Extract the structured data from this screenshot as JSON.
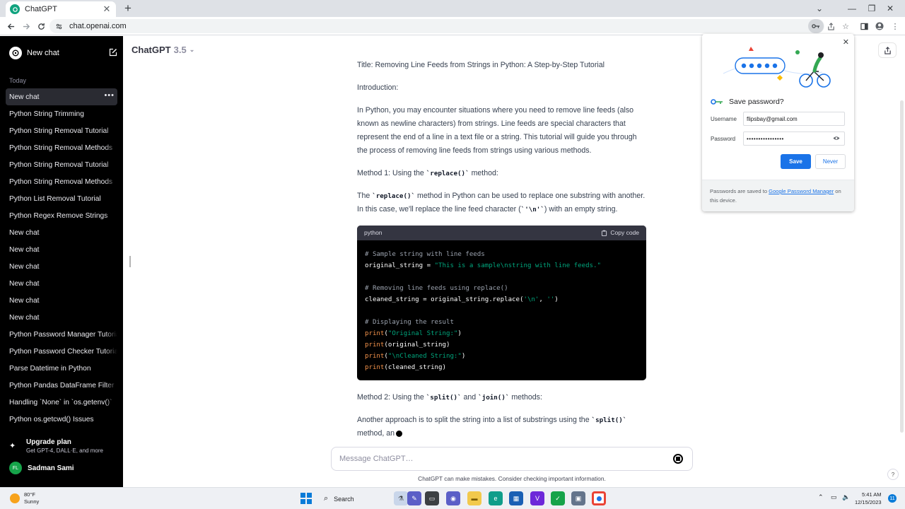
{
  "browser": {
    "tab_title": "ChatGPT",
    "tab_close": "✕",
    "new_tab": "+",
    "url": "chat.openai.com",
    "window_controls": [
      "⌄",
      "—",
      "❐",
      "✕"
    ]
  },
  "sidebar": {
    "new_chat_label": "New chat",
    "section_today": "Today",
    "items": [
      {
        "label": "New chat",
        "active": true
      },
      {
        "label": "Python String Trimming"
      },
      {
        "label": "Python String Removal Tutorial"
      },
      {
        "label": "Python String Removal Methods"
      },
      {
        "label": "Python String Removal Tutorial"
      },
      {
        "label": "Python String Removal Methods"
      },
      {
        "label": "Python List Removal Tutorial"
      },
      {
        "label": "Python Regex Remove Strings"
      },
      {
        "label": "New chat"
      },
      {
        "label": "New chat"
      },
      {
        "label": "New chat"
      },
      {
        "label": "New chat"
      },
      {
        "label": "New chat"
      },
      {
        "label": "New chat"
      },
      {
        "label": "Python Password Manager Tutorial"
      },
      {
        "label": "Python Password Checker Tutorial"
      },
      {
        "label": "Parse Datetime in Python"
      },
      {
        "label": "Python Pandas DataFrame Filter"
      },
      {
        "label": "Handling `None` in `os.getenv()`"
      },
      {
        "label": "Python os.getcwd() Issues"
      }
    ],
    "upgrade_title": "Upgrade plan",
    "upgrade_sub": "Get GPT-4, DALL·E, and more",
    "user_initials": "FL",
    "user_name": "Sadman Sami"
  },
  "header": {
    "model": "ChatGPT",
    "version": "3.5"
  },
  "message": {
    "title_line": "Title: Removing Line Feeds from Strings in Python: A Step-by-Step Tutorial",
    "intro_heading": "Introduction:",
    "intro_body": "In Python, you may encounter situations where you need to remove line feeds (also known as newline characters) from strings. Line feeds are special characters that represent the end of a line in a text file or a string. This tutorial will guide you through the process of removing line feeds from strings using various methods.",
    "m1_pre": "Method 1: Using the ",
    "m1_code": "`replace()`",
    "m1_post": " method:",
    "p2_a": "The ",
    "p2_code1": "`replace()`",
    "p2_b": " method in Python can be used to replace one substring with another. In this case, we'll replace the line feed character (",
    "p2_code2": "`'\\n'`",
    "p2_c": ") with an empty string.",
    "code_lang": "python",
    "copy_label": "Copy code",
    "code": {
      "c1": "# Sample string with line feeds",
      "l2a": "original_string = ",
      "l2s": "\"This is a sample\\nstring with line feeds.\"",
      "c2": "# Removing line feeds using replace()",
      "l4a": "cleaned_string = original_string.replace(",
      "l4s1": "'\\n'",
      "l4b": ", ",
      "l4s2": "''",
      "l4c": ")",
      "c3": "# Displaying the result",
      "pr": "print",
      "l6s": "\"Original String:\"",
      "l7a": "(original_string)",
      "l8s": "\"\\nCleaned String:\"",
      "l9a": "(cleaned_string)"
    },
    "m2_pre": "Method 2: Using the ",
    "m2_code1": "`split()`",
    "m2_mid": " and ",
    "m2_code2": "`join()`",
    "m2_post": " methods:",
    "p3_a": "Another approach is to split the string into a list of substrings using the ",
    "p3_code": "`split()`",
    "p3_b": " method, an"
  },
  "composer": {
    "placeholder": "Message ChatGPT…",
    "disclaimer": "ChatGPT can make mistakes. Consider checking important information.",
    "help": "?"
  },
  "password_popup": {
    "title": "Save password?",
    "username_label": "Username",
    "username_value": "flipsbay@gmail.com",
    "password_label": "Password",
    "password_value": "••••••••••••••••",
    "save_label": "Save",
    "never_label": "Never",
    "footer_pre": "Passwords are saved to ",
    "footer_link": "Google Password Manager",
    "footer_post": " on this device."
  },
  "taskbar": {
    "temp": "80°F",
    "condition": "Sunny",
    "search_label": "Search",
    "time": "5:41 AM",
    "date": "12/15/2023",
    "badge": "11"
  }
}
